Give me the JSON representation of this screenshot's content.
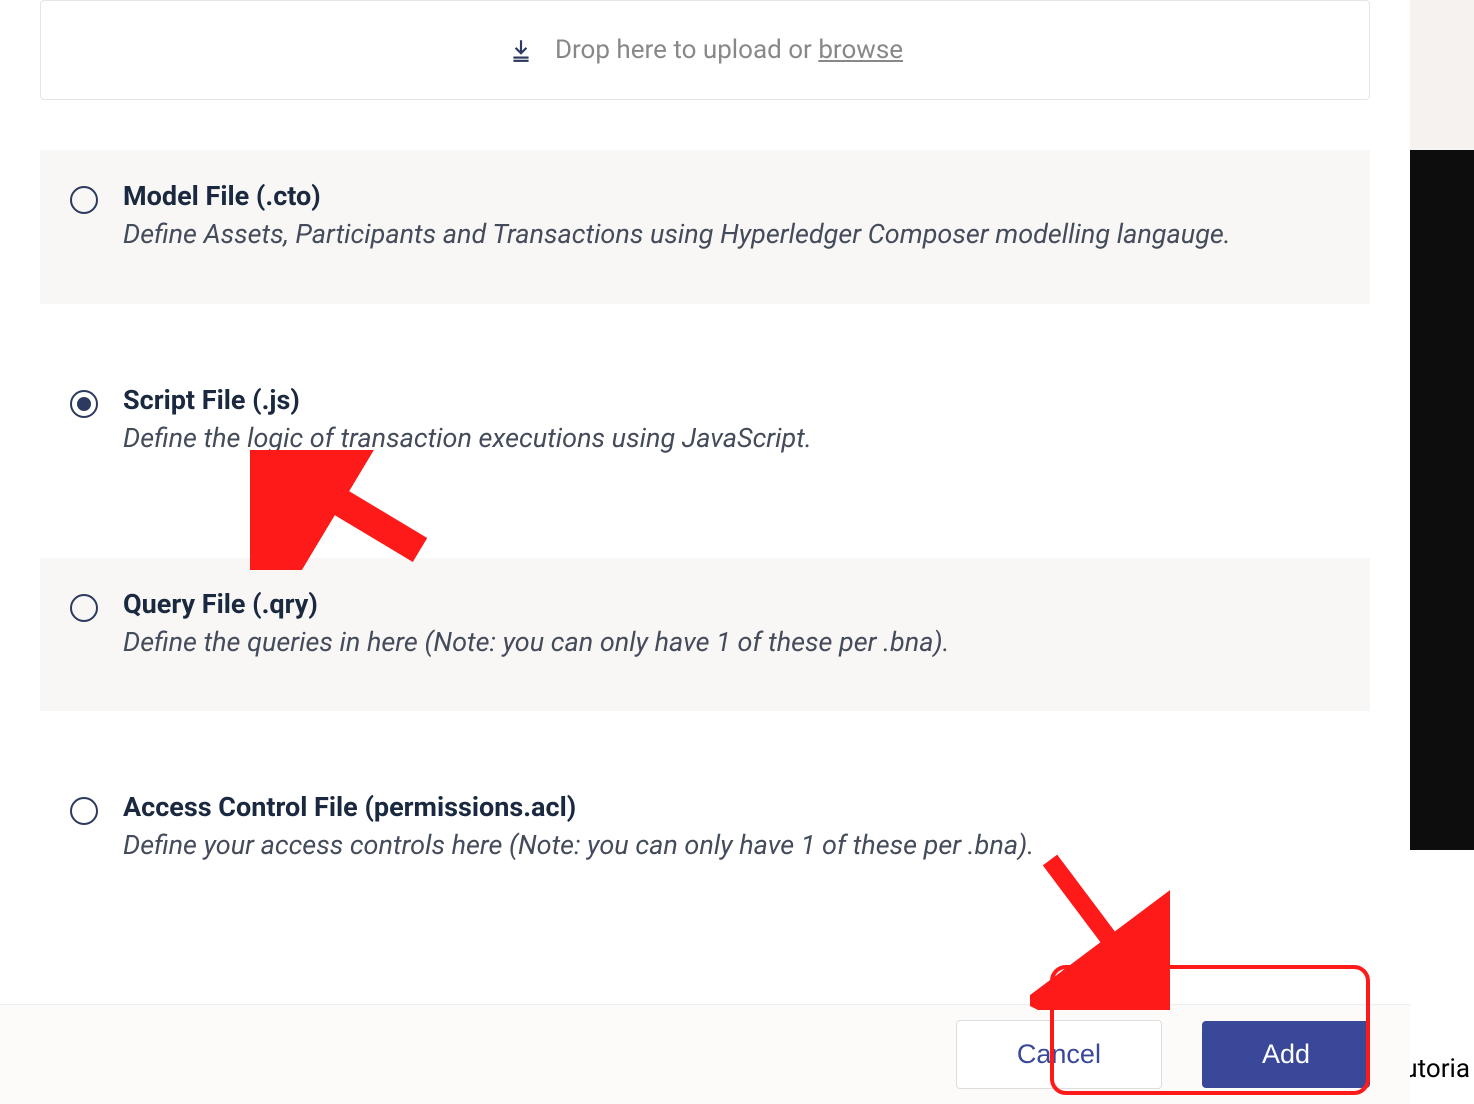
{
  "upload": {
    "text_prefix": "Drop here to upload or ",
    "browse_label": "browse",
    "icon_name": "download-icon"
  },
  "options": [
    {
      "id": "model",
      "title": "Model File (.cto)",
      "description": "Define Assets, Participants and Transactions using Hyperledger Composer modelling langauge.",
      "selected": false,
      "shaded": true
    },
    {
      "id": "script",
      "title": "Script File (.js)",
      "description": "Define the logic of transaction executions using JavaScript.",
      "selected": true,
      "shaded": false
    },
    {
      "id": "query",
      "title": "Query File (.qry)",
      "description": "Define the queries in here (Note: you can only have 1 of these per .bna).",
      "selected": false,
      "shaded": true
    },
    {
      "id": "acl",
      "title": "Access Control File (permissions.acl)",
      "description": "Define your access controls here (Note: you can only have 1 of these per .bna).",
      "selected": false,
      "shaded": false
    }
  ],
  "buttons": {
    "cancel": "Cancel",
    "add": "Add"
  },
  "background": {
    "partial_text": "utoria"
  },
  "annotation": {
    "arrow_color": "#ff1a1a",
    "highlight_color": "#ff1a1a"
  }
}
